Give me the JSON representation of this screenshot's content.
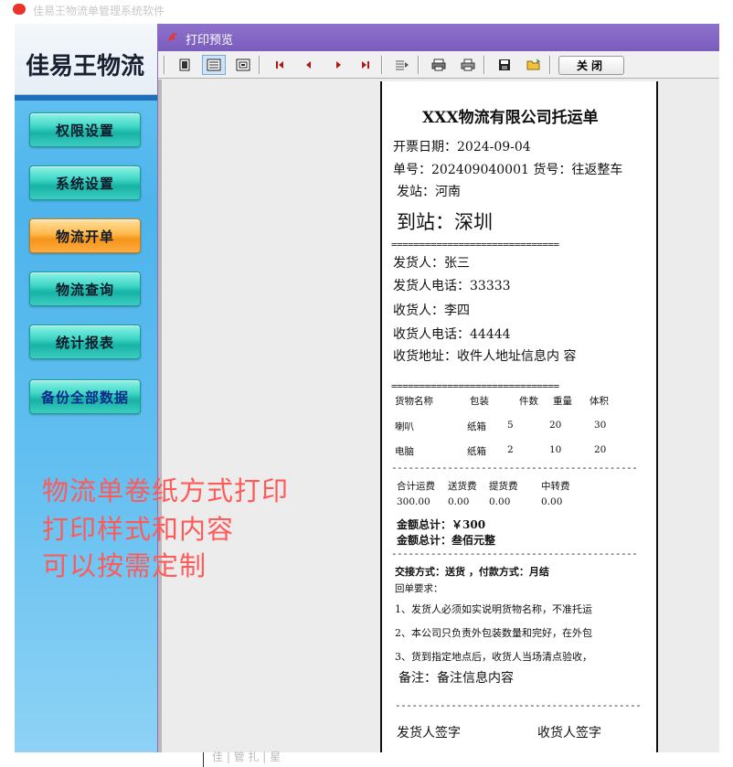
{
  "top_strip": {
    "text": "佳易王物流单管理系统软件"
  },
  "app": {
    "title": "佳易王物流",
    "menu": [
      {
        "label": "权限设置",
        "active": false
      },
      {
        "label": "系统设置",
        "active": false
      },
      {
        "label": "物流开单",
        "active": true
      },
      {
        "label": "物流查询",
        "active": false
      },
      {
        "label": "统计报表",
        "active": false
      },
      {
        "label": "备份全部数据",
        "active": false
      }
    ]
  },
  "overlay_text": [
    "物流单卷纸方式打印",
    "打印样式和内容",
    "可以按需定制"
  ],
  "dialog": {
    "title": "打印预览",
    "close_label": "关闭"
  },
  "receipt": {
    "title": "XXX物流有限公司托运单",
    "date": "开票日期：2024-09-04",
    "order_line": "单号：202409040001 货号：往返整车",
    "from": "发站：河南",
    "to": "到站：深圳",
    "separator": "==============================",
    "shipper": "发货人：张三",
    "shipper_phone": "发货人电话：33333",
    "receiver": "收货人：李四",
    "receiver_phone": "收货人电话：44444",
    "receiver_address": "收货地址：收件人地址信息内 容",
    "goods_header": [
      "货物名称",
      "包装",
      "件数",
      "重量",
      "体积"
    ],
    "goods": [
      [
        "喇叭",
        "纸箱",
        "5",
        "20",
        "30"
      ],
      [
        "电脑",
        "纸箱",
        "2",
        "10",
        "20"
      ]
    ],
    "dash_line": "--------------------------------------------",
    "fee_header": [
      "合计运费",
      "送货费",
      "提货费",
      "中转费"
    ],
    "fee_values": [
      "300.00",
      "0.00",
      "0.00",
      "0.00"
    ],
    "total_amount": "金额总计：￥300",
    "total_chinese": "金额总计：叁佰元整",
    "delivery_line": "交接方式：送货 ，付款方式：月结",
    "requirements_title": "回单要求：",
    "rules": [
      "1、发货人必须如实说明货物名称，不准托运",
      "2、本公司只负责外包装数量和完好，在外包",
      "3、货到指定地点后，收货人当场清点验收，"
    ],
    "remark": "备注：备注信息内容",
    "sign_shipper": "发货人签字",
    "sign_receiver": "收货人签字"
  },
  "bottom_strip": {
    "text": "佳 | 管 扎 | 星"
  },
  "colors": {
    "titlebar": "#7a5cbd",
    "app_bg": "#4db4ec",
    "menu_btn": "#3fd6c6",
    "menu_active": "#f5941a",
    "overlay": "#ff5a5a"
  }
}
